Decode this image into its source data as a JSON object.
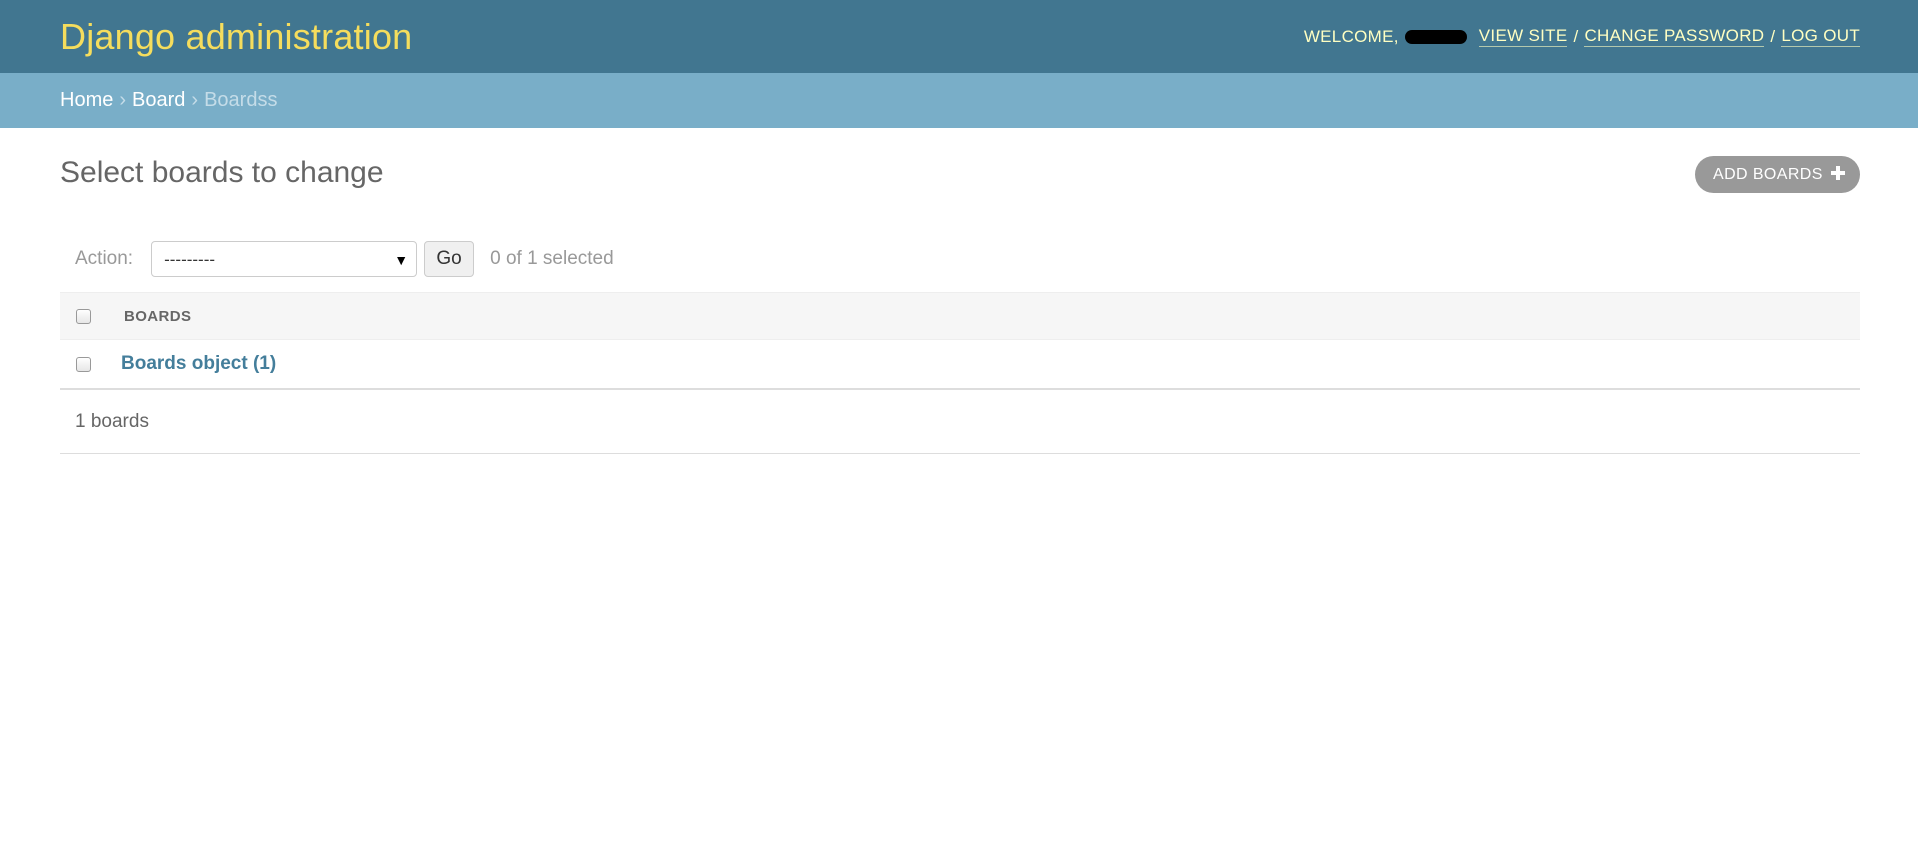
{
  "header": {
    "brand": "Django administration",
    "welcome": "WELCOME,",
    "view_site": "VIEW SITE",
    "change_password": "CHANGE PASSWORD",
    "log_out": "LOG OUT",
    "separator": "/"
  },
  "breadcrumbs": {
    "home": "Home",
    "app": "Board",
    "current": "Boardss",
    "arrow": "›"
  },
  "content": {
    "title": "Select boards to change",
    "add_button": "ADD BOARDS"
  },
  "actions": {
    "label": "Action:",
    "selected_option": "---------",
    "go_label": "Go",
    "counter": "0 of 1 selected"
  },
  "table": {
    "column_header": "BOARDS",
    "rows": [
      {
        "label": "Boards object (1)"
      }
    ]
  },
  "paginator": {
    "count_text": "1 boards"
  },
  "colors": {
    "header_bg": "#417690",
    "brand": "#f5dd5d",
    "breadcrumbs_bg": "#79aec8",
    "link": "#447e9b",
    "add_button_bg": "#999999"
  },
  "icons": {
    "add": "plus-icon",
    "select_caret": "caret-down-icon"
  }
}
